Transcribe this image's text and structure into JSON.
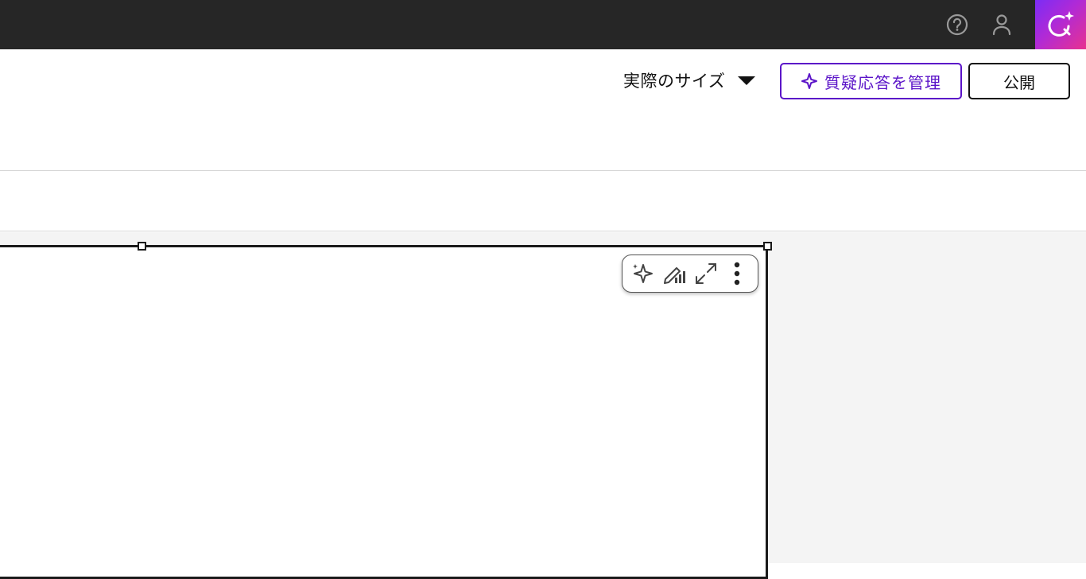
{
  "topbar": {
    "icons": [
      "help-circle-icon",
      "user-icon",
      "copilot-icon"
    ],
    "copilot_gradient": [
      "#7b2cf5",
      "#e8328f"
    ]
  },
  "toolbar": {
    "view_size_label": "実際のサイズ",
    "qa_button_label": "質疑応答を管理",
    "publish_label": "公開",
    "accent": "#5b14c8"
  },
  "visual_header": {
    "icons": [
      "sparkle-icon",
      "edit-chart-icon",
      "focus-mode-icon",
      "more-options-icon"
    ]
  }
}
